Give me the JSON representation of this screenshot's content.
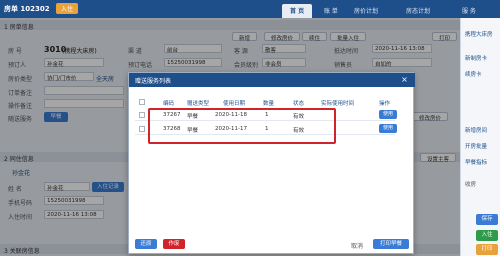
{
  "topbar": {
    "title": "房单 102302",
    "badge": "入住",
    "tabs": [
      "首 页",
      "账 单",
      "房价计划",
      "房态计划",
      "服 务"
    ]
  },
  "rightcol": {
    "items": [
      "携程大床房",
      "新制房卡",
      "续房卡",
      "新增房间",
      "开房批量",
      "早餐指标"
    ],
    "buttons": [
      "保存",
      "入住",
      "打印"
    ],
    "exit": "×",
    "tag": "收房"
  },
  "section1": {
    "head": "1 房单信息",
    "buttons": [
      "新增",
      "修改房价",
      "续住",
      "批量入住",
      "打印"
    ],
    "labels": {
      "room": "房 号",
      "channel": "渠 道",
      "customer": "客 源",
      "arrival": "抵达时间",
      "guest": "预订人",
      "phone": "预订电话",
      "member": "会员级别",
      "price": "房价类型",
      "order_remark": "订单备注",
      "ops_remark": "操作备注",
      "follow_service": "随送服务",
      "agreement": "协议单位",
      "sales": "销售员"
    },
    "values": {
      "room": "3010",
      "room_type": "(携程大床房)",
      "channel": "前台",
      "customer": "散客",
      "arrival": "2020-11-16 13:08",
      "guest": "孙金花",
      "phone": "15250031998",
      "member": "非会员",
      "sales_value": "自如的",
      "price_value": "协门/门市价",
      "price_suffix": "全天房",
      "follow_btn": "早餐",
      "modify_btn": "修改房价"
    }
  },
  "section2": {
    "head": "2 同住信息",
    "tab": "孙金花",
    "labels": {
      "name": "姓 名",
      "phone": "手机号码",
      "checkin": "入住时间"
    },
    "values": {
      "name": "孙金花",
      "checkin_btn": "入住记录",
      "phone": "15250031998",
      "checkin": "2020-11-16 13:08"
    },
    "side_btn": "设置主客"
  },
  "section3": {
    "head": "3 关联房信息"
  },
  "modal": {
    "title": "赠送服务列表",
    "close": "×",
    "columns": [
      "编码",
      "赠送类型",
      "使用日期",
      "数量",
      "状态",
      "实际使用时间",
      "操作"
    ],
    "rows": [
      {
        "code": "37267",
        "type": "早餐",
        "date": "2020-11-18",
        "qty": "1",
        "status": "有效",
        "time": "",
        "action": "使用"
      },
      {
        "code": "37268",
        "type": "早餐",
        "date": "2020-11-17",
        "qty": "1",
        "status": "有效",
        "time": "",
        "action": "使用"
      }
    ],
    "footer": {
      "add": "还原",
      "delete": "作废",
      "print": "打印早餐",
      "cancel": "取消"
    }
  },
  "colors": {
    "brand": "#1f4f8a",
    "accent": "#e9a23b",
    "danger": "#d1232a",
    "primary_btn": "#3a7bd5",
    "success": "#2e9b4a"
  }
}
